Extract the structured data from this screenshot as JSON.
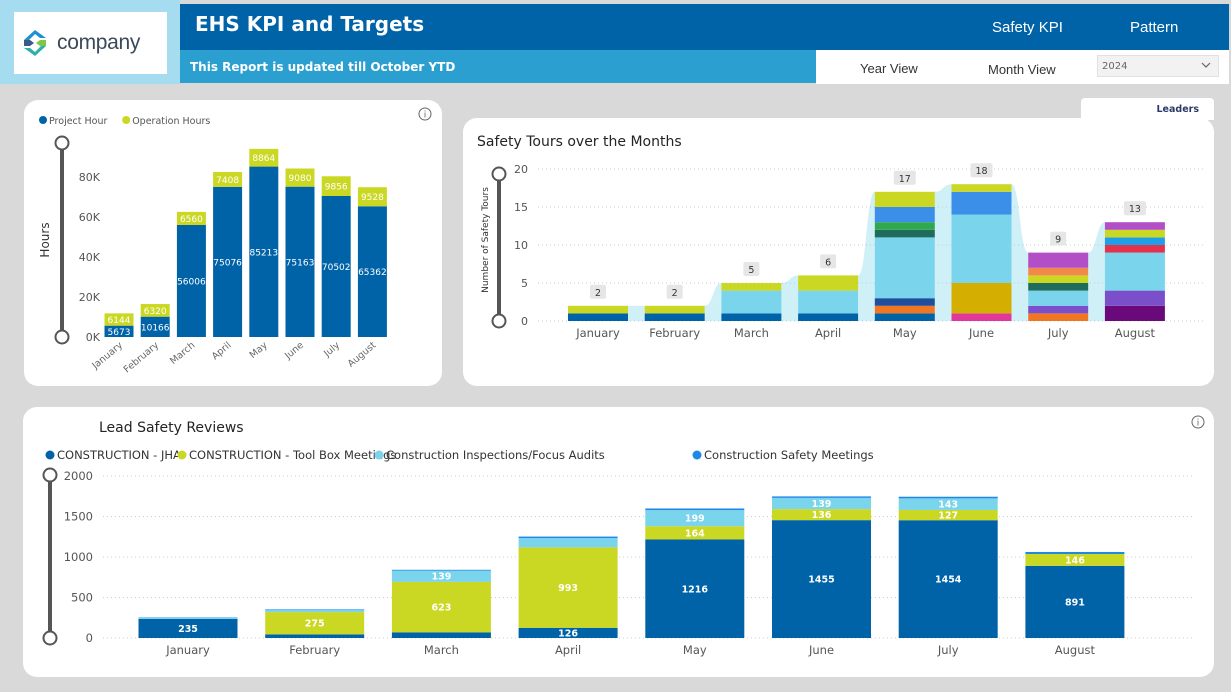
{
  "header": {
    "logo_text": "company",
    "title": "EHS KPI and Targets",
    "nav": [
      "Safety KPI",
      "Pattern"
    ],
    "subtitle": "This Report is updated till October YTD",
    "views": [
      "Year View",
      "Month View"
    ],
    "year_selected": "2024",
    "leaders_tab": "Leaders"
  },
  "colors": {
    "header_blue": "#0063a8",
    "subbar_blue": "#2c9fd1",
    "navy": "#0063a8",
    "lime": "#cbd823",
    "light_blue": "#79d4ec",
    "blue": "#1e88e5"
  },
  "chart_data": [
    {
      "type": "bar",
      "stacked": true,
      "categories": [
        "January",
        "February",
        "March",
        "April",
        "May",
        "June",
        "July",
        "August"
      ],
      "series": [
        {
          "name": "Project Hour",
          "color": "#0063a8",
          "values": [
            5673,
            10166,
            56006,
            75076,
            85213,
            75163,
            70502,
            65362
          ]
        },
        {
          "name": "Operation Hours",
          "color": "#cbd823",
          "values": [
            6144,
            6320,
            6560,
            7408,
            8864,
            9080,
            9856,
            9528
          ]
        }
      ],
      "ylabel": "Hours",
      "yticks": [
        "0K",
        "20K",
        "40K",
        "60K",
        "80K"
      ],
      "ylim": [
        0,
        100000
      ],
      "legend": "top-left"
    },
    {
      "type": "bar",
      "stacked": true,
      "title": "Safety Tours over the Months",
      "ylabel": "Number of Safety Tours",
      "categories": [
        "January",
        "February",
        "March",
        "April",
        "May",
        "June",
        "July",
        "August"
      ],
      "totals": [
        2,
        2,
        5,
        6,
        17,
        18,
        9,
        13
      ],
      "yticks": [
        "0",
        "5",
        "10",
        "15",
        "20"
      ],
      "ylim": [
        0,
        20
      ],
      "segments": [
        [
          {
            "c": "#0063a8",
            "v": 1
          },
          {
            "c": "#cbd823",
            "v": 1
          }
        ],
        [
          {
            "c": "#0063a8",
            "v": 1
          },
          {
            "c": "#cbd823",
            "v": 1
          }
        ],
        [
          {
            "c": "#0063a8",
            "v": 1
          },
          {
            "c": "#79d4ec",
            "v": 3
          },
          {
            "c": "#cbd823",
            "v": 1
          }
        ],
        [
          {
            "c": "#0063a8",
            "v": 1
          },
          {
            "c": "#79d4ec",
            "v": 3
          },
          {
            "c": "#cbd823",
            "v": 2
          }
        ],
        [
          {
            "c": "#0063a8",
            "v": 1
          },
          {
            "c": "#f07621",
            "v": 1
          },
          {
            "c": "#1e4e9c",
            "v": 1
          },
          {
            "c": "#79d4ec",
            "v": 8
          },
          {
            "c": "#1f6b5c",
            "v": 1
          },
          {
            "c": "#2fa84f",
            "v": 1
          },
          {
            "c": "#3b8fe8",
            "v": 2
          },
          {
            "c": "#cbd823",
            "v": 2
          }
        ],
        [
          {
            "c": "#e0389a",
            "v": 1
          },
          {
            "c": "#d4ae00",
            "v": 4
          },
          {
            "c": "#79d4ec",
            "v": 9
          },
          {
            "c": "#3b8fe8",
            "v": 3
          },
          {
            "c": "#cbd823",
            "v": 1
          }
        ],
        [
          {
            "c": "#f07621",
            "v": 1
          },
          {
            "c": "#7b4fc9",
            "v": 1
          },
          {
            "c": "#79d4ec",
            "v": 2
          },
          {
            "c": "#1f6b5c",
            "v": 1
          },
          {
            "c": "#cbd823",
            "v": 1
          },
          {
            "c": "#f2894a",
            "v": 1
          },
          {
            "c": "#b24fc7",
            "v": 2
          }
        ],
        [
          {
            "c": "#6a0a7a",
            "v": 2
          },
          {
            "c": "#7b4fc9",
            "v": 2
          },
          {
            "c": "#79d4ec",
            "v": 5
          },
          {
            "c": "#e3324c",
            "v": 1
          },
          {
            "c": "#1ea0e8",
            "v": 1
          },
          {
            "c": "#cbd823",
            "v": 1
          },
          {
            "c": "#b24fc7",
            "v": 1
          }
        ]
      ]
    },
    {
      "type": "bar",
      "stacked": true,
      "title": "Lead Safety Reviews",
      "categories": [
        "January",
        "February",
        "March",
        "April",
        "May",
        "June",
        "July",
        "August"
      ],
      "series": [
        {
          "name": "CONSTRUCTION - JHA",
          "color": "#0063a8",
          "values": [
            235,
            45,
            70,
            126,
            1216,
            1455,
            1454,
            891
          ]
        },
        {
          "name": "CONSTRUCTION - Tool Box Meetings",
          "color": "#cbd823",
          "values": [
            0,
            275,
            623,
            993,
            164,
            136,
            127,
            146
          ]
        },
        {
          "name": "Construction Inspections/Focus Audits",
          "color": "#79d4ec",
          "values": [
            15,
            25,
            139,
            115,
            199,
            139,
            143,
            0
          ]
        },
        {
          "name": "Construction Safety Meetings",
          "color": "#1e88e5",
          "values": [
            5,
            8,
            10,
            18,
            20,
            18,
            20,
            25
          ]
        }
      ],
      "labels": {
        "CONSTRUCTION - JHA": [
          235,
          null,
          null,
          126,
          1216,
          1455,
          1454,
          891
        ],
        "CONSTRUCTION - Tool Box Meetings": [
          null,
          275,
          623,
          993,
          164,
          136,
          127,
          146
        ],
        "Construction Inspections/Focus Audits": [
          null,
          null,
          139,
          null,
          199,
          139,
          143,
          null
        ]
      },
      "yticks": [
        "0",
        "500",
        "1000",
        "1500",
        "2000"
      ],
      "ylim": [
        0,
        2000
      ],
      "legend": "top-left"
    }
  ]
}
